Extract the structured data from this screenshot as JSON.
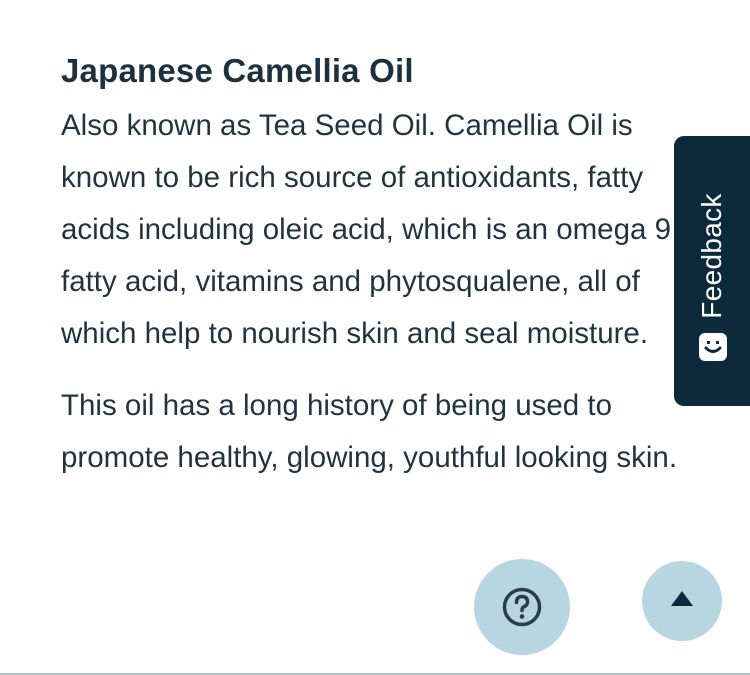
{
  "section": {
    "title": "Japanese Camellia Oil",
    "paragraphs": [
      "Also known as Tea Seed Oil. Camellia Oil is known to be rich source of antioxidants, fatty acids including oleic acid, which is an omega 9 fatty acid, vitamins and phytosqualene, all of which help to nourish skin and seal moisture.",
      "This oil has a long history of being used to promote healthy, glowing, youthful looking skin."
    ]
  },
  "feedback": {
    "label": "Feedback",
    "icon": "smiley-icon",
    "background": "#0d2a3c"
  },
  "help_button": {
    "icon": "question-circle-icon",
    "background": "#b7d6e1"
  },
  "scroll_top_button": {
    "icon": "caret-up-icon",
    "background": "#b7d6e1"
  }
}
